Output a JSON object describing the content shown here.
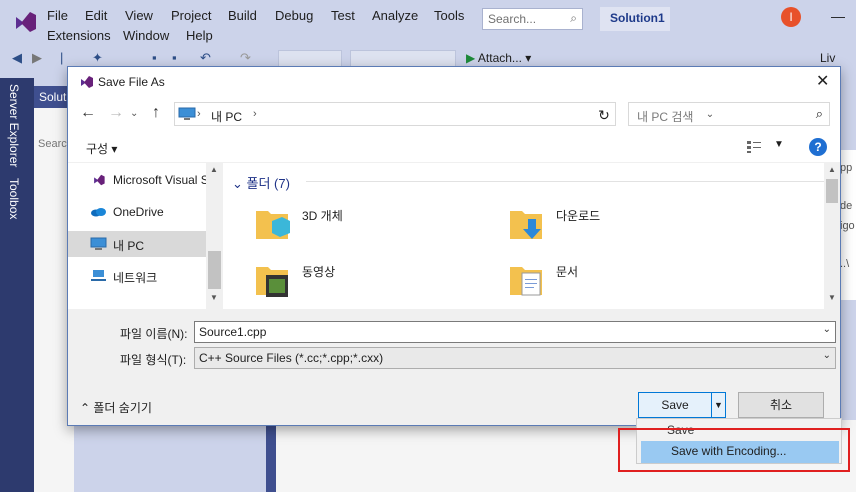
{
  "vs": {
    "menu": [
      "File",
      "Edit",
      "View",
      "Project",
      "Build",
      "Debug",
      "Test",
      "Analyze",
      "Tools",
      "Extensions",
      "Window",
      "Help"
    ],
    "search_placeholder": "Search...",
    "solution_name": "Solution1",
    "avatar_initial": "I",
    "attach_label": "Attach...",
    "live_label": "Liv",
    "rail_tabs": [
      "Server Explorer",
      "Toolbox"
    ],
    "panel_title": "Soluti",
    "panel_search": "Searc",
    "right_fragments": [
      "pp",
      "de",
      "igo",
      "..\\"
    ]
  },
  "dialog": {
    "title": "Save File As",
    "address": "내 PC",
    "search_placeholder": "내 PC 검색",
    "organize_label": "구성",
    "nav_items": [
      "Microsoft Visual S",
      "OneDrive",
      "내 PC",
      "네트워크"
    ],
    "group_header": "폴더 (7)",
    "files": [
      "3D 개체",
      "다운로드",
      "동영상",
      "문서"
    ],
    "filename_label": "파일 이름(N):",
    "filename_value": "Source1.cpp",
    "filetype_label": "파일 형식(T):",
    "filetype_value": "C++ Source Files (*.cc;*.cpp;*.cxx)",
    "hide_folders_label": "폴더 숨기기",
    "save_label": "Save",
    "cancel_label": "취소"
  },
  "save_menu": {
    "items": [
      "Save",
      "Save with Encoding..."
    ]
  },
  "colors": {
    "accent": "#0078d7",
    "vs_chrome": "#ccd3ea",
    "highlight_box": "#e02020",
    "menu_selected": "#99c9f2"
  }
}
